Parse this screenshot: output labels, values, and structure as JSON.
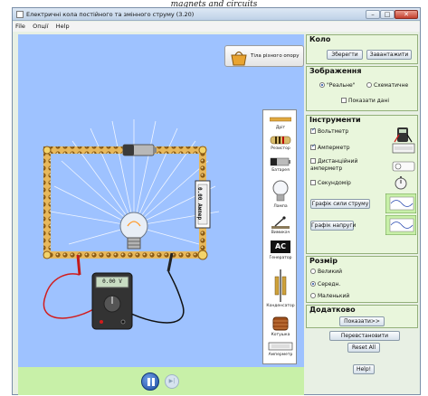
{
  "caption": "magnets and circuits",
  "window": {
    "title": "Електричні кола постійного та змінного струму (3.20)",
    "controls": {
      "minimize": "–",
      "maximize": "□",
      "close": "✕"
    }
  },
  "menu": [
    "File",
    "Опції",
    "Help"
  ],
  "grab_bag": {
    "label": "Тіла різного опору"
  },
  "toolbox": {
    "items": [
      {
        "label": "Дріт",
        "icon": "wire-icon"
      },
      {
        "label": "Резистор",
        "icon": "resistor-icon"
      },
      {
        "label": "Батарея",
        "icon": "battery-icon"
      },
      {
        "label": "Лампа",
        "icon": "bulb-icon"
      },
      {
        "label": "Вимикач",
        "icon": "switch-icon"
      },
      {
        "label": "Генератор",
        "icon": "ac-generator-icon",
        "glyph": "AC"
      },
      {
        "label": "Конденсатор",
        "icon": "capacitor-icon"
      },
      {
        "label": "Котушка",
        "icon": "inductor-icon"
      },
      {
        "label": "Амперметр",
        "icon": "ammeter-icon"
      }
    ]
  },
  "circuit": {
    "ammeter_reading": "0.00 Ампер",
    "voltmeter_reading": "0.00 V"
  },
  "panels": {
    "circuit": {
      "title": "Коло",
      "save": "Зберегти",
      "load": "Завантажити"
    },
    "view": {
      "title": "Зображення",
      "realistic": "\"Реальне\"",
      "schematic": "Схематичне",
      "realistic_selected": true,
      "show_values": "Показати дані",
      "show_values_checked": false
    },
    "tools": {
      "title": "Інструменти",
      "voltmeter": "Вольтметр",
      "voltmeter_checked": true,
      "ammeter": "Амперметр",
      "ammeter_checked": true,
      "noncontact_ammeter": "Дистанційний амперметр",
      "noncontact_checked": false,
      "stopwatch": "Секундомір",
      "stopwatch_checked": false,
      "current_chart": "Графік сили струму",
      "voltage_chart": "Графік напруги"
    },
    "size": {
      "title": "Розмір",
      "large": "Великий",
      "medium": "Середн.",
      "small": "Маленький",
      "selected": "medium"
    },
    "advanced": {
      "title": "Додатково",
      "show": "Показати>>",
      "reset_dynamics": "Перевстановити",
      "reset_all": "Reset All",
      "help": "Help!"
    }
  },
  "colors": {
    "canvas": "#9ec2ff",
    "bottom_bar": "#c8f0a8",
    "panel_bg": "#e9f6dc",
    "wire": "#d9a54a",
    "battery": "#b8b8b8"
  }
}
